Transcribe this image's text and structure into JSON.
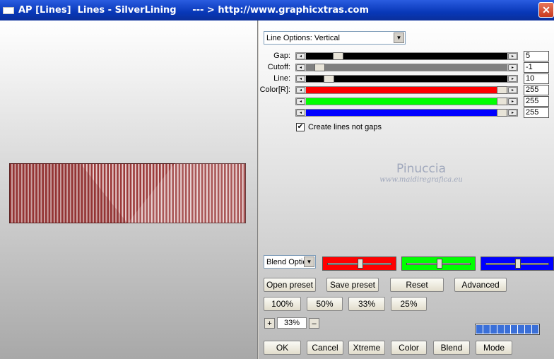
{
  "window": {
    "title": "AP [Lines]  Lines - SilverLining     --- > http://www.graphicxtras.com",
    "close_label": "✕"
  },
  "options": {
    "line_options_selected": "Line Options: Vertical",
    "blend_options_selected": "Blend Optio"
  },
  "sliders": [
    {
      "label": "Gap:",
      "value": "5",
      "fraction": 0.1,
      "fill": "#000000"
    },
    {
      "label": "Cutoff:",
      "value": "-1",
      "fraction": 0.0,
      "fill": "#808080"
    },
    {
      "label": "Line:",
      "value": "10",
      "fraction": 0.05,
      "fill": "#000000"
    },
    {
      "label": "Color[R]:",
      "value": "255",
      "fraction": 1.0,
      "fill": "#ff0000"
    },
    {
      "label": "",
      "value": "255",
      "fraction": 1.0,
      "fill": "#00ff00"
    },
    {
      "label": "",
      "value": "255",
      "fraction": 1.0,
      "fill": "#0000ff"
    }
  ],
  "checkbox": {
    "label": "Create lines not gaps",
    "checked": true,
    "mark": "✔"
  },
  "watermark": {
    "line1": "Pinuccia",
    "line2": "www.maidiregrafica.eu"
  },
  "color_blocks": [
    {
      "color": "#ff0000",
      "position": 0.5
    },
    {
      "color": "#00ff00",
      "position": 0.5
    },
    {
      "color": "#0000ff",
      "position": 0.5
    }
  ],
  "buttons": {
    "open_preset": "Open preset",
    "save_preset": "Save preset",
    "reset": "Reset",
    "advanced": "Advanced",
    "zoom_100": "100%",
    "zoom_50": "50%",
    "zoom_33": "33%",
    "zoom_25": "25%",
    "ok": "OK",
    "cancel": "Cancel",
    "xtreme": "Xtreme",
    "color": "Color",
    "blend": "Blend",
    "mode": "Mode"
  },
  "zoom": {
    "plus": "+",
    "minus": "–",
    "value": "33%"
  },
  "preview": {
    "base_color": "#9b3a3a",
    "stripe_color": "#f4e8e8"
  }
}
